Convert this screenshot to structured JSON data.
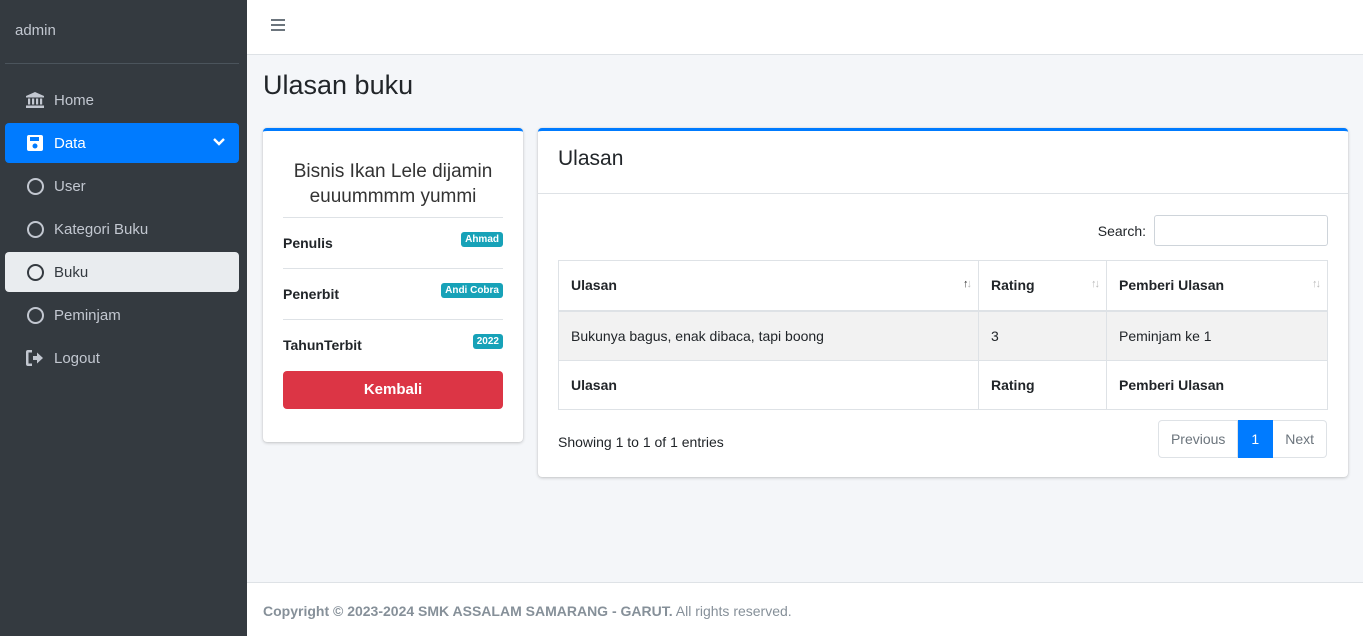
{
  "sidebar": {
    "brand": "admin",
    "items": [
      {
        "label": "Home",
        "icon": "bank-icon"
      },
      {
        "label": "Data",
        "icon": "save-icon"
      },
      {
        "label": "User",
        "icon": "circle-icon"
      },
      {
        "label": "Kategori Buku",
        "icon": "circle-icon"
      },
      {
        "label": "Buku",
        "icon": "circle-icon"
      },
      {
        "label": "Peminjam",
        "icon": "circle-icon"
      },
      {
        "label": "Logout",
        "icon": "logout-icon"
      }
    ]
  },
  "page": {
    "title": "Ulasan buku"
  },
  "book": {
    "title": "Bisnis Ikan Lele dijamin euuummmm yummi",
    "props": [
      {
        "label": "Penulis",
        "value": "Ahmad"
      },
      {
        "label": "Penerbit",
        "value": "Andi Cobra"
      },
      {
        "label": "TahunTerbit",
        "value": "2022"
      }
    ],
    "back_label": "Kembali"
  },
  "review": {
    "header": "Ulasan",
    "search_label": "Search:",
    "columns": [
      "Ulasan",
      "Rating",
      "Pemberi Ulasan"
    ],
    "rows": [
      [
        "Bukunya bagus, enak dibaca, tapi boong",
        "3",
        "Peminjam ke 1"
      ]
    ],
    "info": "Showing 1 to 1 of 1 entries",
    "pager": {
      "prev": "Previous",
      "current": "1",
      "next": "Next"
    }
  },
  "footer": {
    "copyright": "Copyright © 2023-2024 SMK ASSALAM SAMARANG - GARUT.",
    "rights": " All rights reserved."
  },
  "colors": {
    "primary": "#007bff",
    "danger": "#dc3545",
    "info": "#17a2b8",
    "sidebar": "#343a40"
  }
}
